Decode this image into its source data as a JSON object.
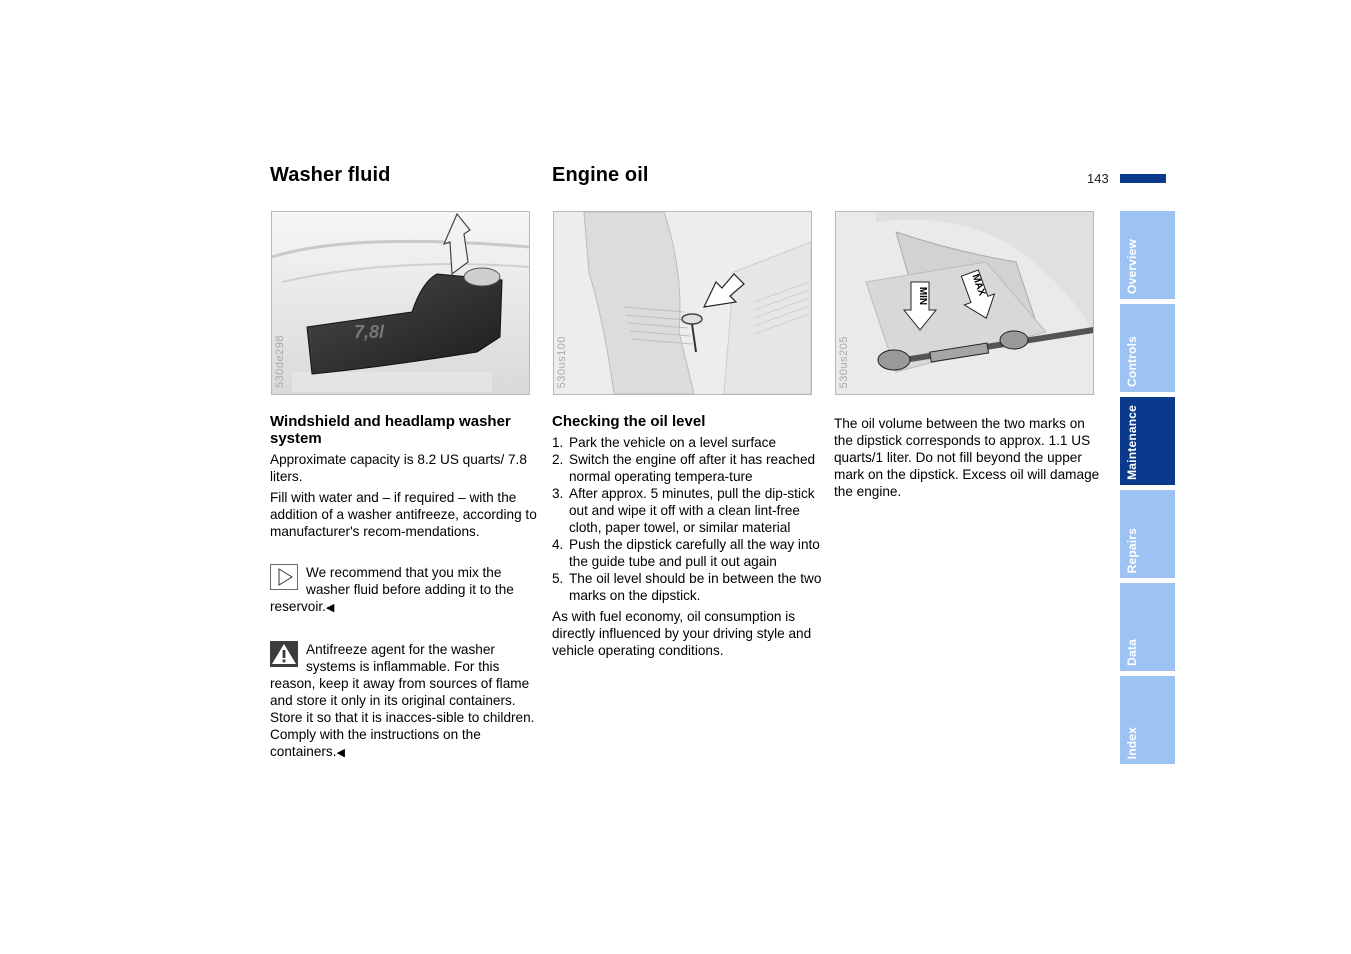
{
  "header": {
    "left_title": "Washer fluid",
    "right_title": "Engine oil",
    "page_number": "143",
    "accent_color": "#0b3a8c"
  },
  "figures": [
    {
      "code": "530de298",
      "description": "Washer fluid reservoir with arrow pointing to filler cap",
      "label_on_image": "7,8l"
    },
    {
      "code": "530us100",
      "description": "Engine oil dipstick location with arrow"
    },
    {
      "code": "530us205",
      "description": "Dipstick with MIN and MAX marks",
      "marks": [
        "MIN",
        "MAX"
      ]
    }
  ],
  "washer": {
    "heading": "Windshield and headlamp washer system",
    "capacity": "Approximate capacity is 8.2 US quarts/ 7.8 liters.",
    "fill": "Fill with water and – if required – with the addition of a washer antifreeze, according to manufacturer's recom-mendations.",
    "tip": "We recommend that you mix the washer fluid before adding it to the reservoir.",
    "warning": "Antifreeze agent for the washer systems is inflammable. For this reason, keep it away from sources of flame and store it only in its original containers. Store it so that it is inacces-sible to children. Comply with the instructions on the containers.",
    "end_mark": "◀"
  },
  "oil": {
    "heading": "Checking the oil level",
    "steps": [
      {
        "num": "1.",
        "text": "Park the vehicle on a level surface"
      },
      {
        "num": "2.",
        "text": "Switch the engine off after it has reached normal operating tempera-ture"
      },
      {
        "num": "3.",
        "text": "After approx. 5 minutes, pull the dip-stick out and wipe it off with a clean lint-free cloth, paper towel, or similar material"
      },
      {
        "num": "4.",
        "text": "Push the dipstick carefully all the way into the guide tube and pull it out again"
      },
      {
        "num": "5.",
        "text": "The oil level should be in between the two marks on the dipstick."
      }
    ],
    "consumption": "As with fuel economy, oil consumption is directly influenced by your driving style and vehicle operating conditions.",
    "volume_note": "The oil volume between the two marks on the dipstick corresponds to approx. 1.1 US quarts/1 liter. Do not fill beyond the upper mark on the dipstick. Excess oil will damage the engine."
  },
  "side_tabs": [
    {
      "label": "Overview",
      "active": false
    },
    {
      "label": "Controls",
      "active": false
    },
    {
      "label": "Maintenance",
      "active": true
    },
    {
      "label": "Repairs",
      "active": false
    },
    {
      "label": "Data",
      "active": false
    },
    {
      "label": "Index",
      "active": false
    }
  ],
  "colors": {
    "tab_inactive": "#9cc3f4",
    "tab_active": "#0b3a8c"
  }
}
